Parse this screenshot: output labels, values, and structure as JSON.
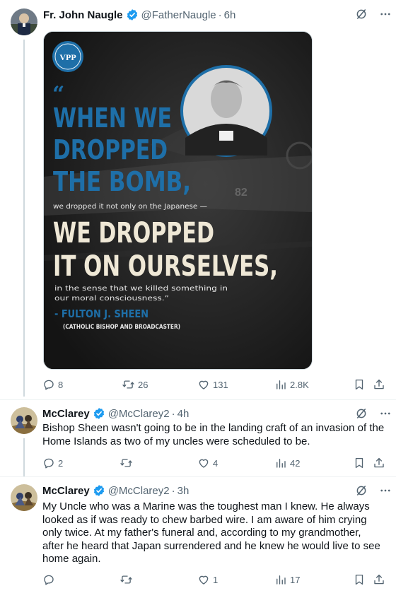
{
  "tweet1": {
    "name": "Fr. John Naugle",
    "handle": "@FatherNaugle",
    "time": "6h",
    "media": {
      "logo": "VPP",
      "quote_mark": "“",
      "line1": "WHEN WE",
      "line2": "DROPPED",
      "line3": "THE BOMB,",
      "sub1": "we dropped it not only on the Japanese —",
      "big1": "WE DROPPED",
      "big2": "IT ON OURSELVES,",
      "small1": "in the sense that we killed something in",
      "small2": "our moral consciousness.”",
      "author": "- FULTON J. SHEEN",
      "author_role": "(CATHOLIC BISHOP AND BROADCASTER)",
      "plane_marking": "82"
    },
    "replies": "8",
    "reposts": "26",
    "likes": "131",
    "views": "2.8K"
  },
  "tweet2": {
    "name": "McClarey",
    "handle": "@McClarey2",
    "time": "4h",
    "text": "Bishop Sheen wasn't going to be in the landing craft of an invasion of the Home Islands as two of my uncles were scheduled to be.",
    "replies": "2",
    "reposts": "",
    "likes": "4",
    "views": "42"
  },
  "tweet3": {
    "name": "McClarey",
    "handle": "@McClarey2",
    "time": "3h",
    "text": "My Uncle who was a Marine was the toughest man I knew.  He always looked as if was ready to chew barbed wire.  I am aware of him crying only twice.  At my father's funeral and, according to my grandmother, after he heard that Japan surrendered and he knew he would live to see home again.",
    "replies": "",
    "reposts": "",
    "likes": "1",
    "views": "17"
  },
  "separator": "·",
  "colors": {
    "accent": "#1d9bf0",
    "secondary_text": "#536471",
    "poster_blue": "#1e6fa8",
    "poster_cream": "#efe8d6"
  }
}
